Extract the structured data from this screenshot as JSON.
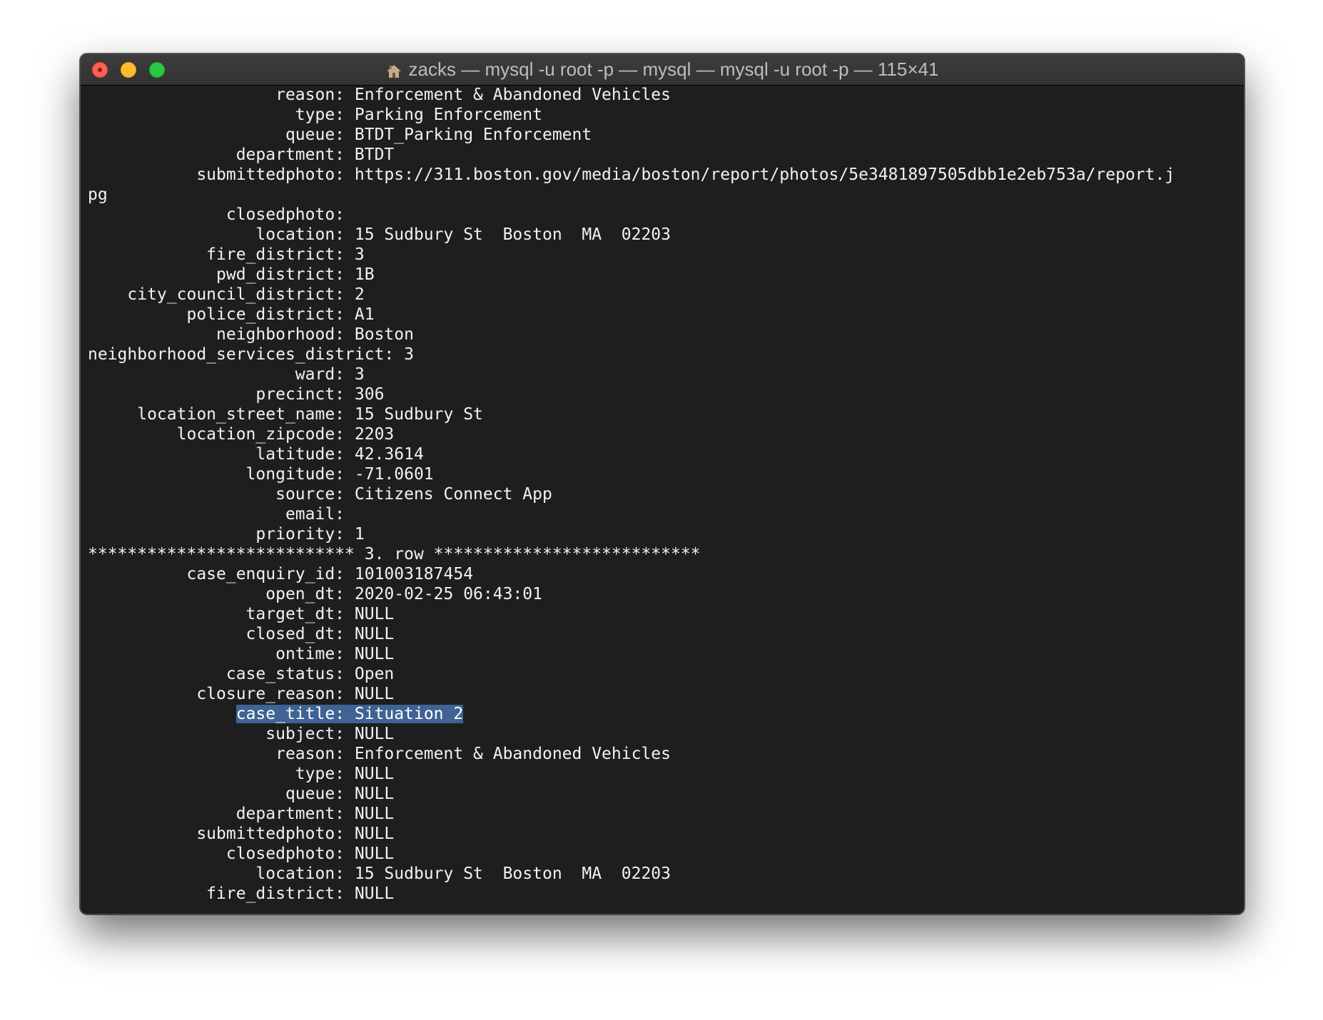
{
  "window": {
    "title": "zacks — mysql -u root -p — mysql — mysql -u root -p — 115×41",
    "title_icon": "house-icon"
  },
  "terminal": {
    "lines": [
      "                   reason: Enforcement & Abandoned Vehicles",
      "                     type: Parking Enforcement",
      "                    queue: BTDT_Parking Enforcement",
      "               department: BTDT",
      "           submittedphoto: https://311.boston.gov/media/boston/report/photos/5e3481897505dbb1e2eb753a/report.j",
      "pg",
      "              closedphoto: ",
      "                 location: 15 Sudbury St  Boston  MA  02203",
      "            fire_district: 3",
      "             pwd_district: 1B",
      "    city_council_district: 2",
      "          police_district: A1",
      "             neighborhood: Boston",
      "neighborhood_services_district: 3",
      "                     ward: 3",
      "                 precinct: 306",
      "     location_street_name: 15 Sudbury St",
      "         location_zipcode: 2203",
      "                 latitude: 42.3614",
      "                longitude: -71.0601",
      "                   source: Citizens Connect App",
      "                    email: ",
      "                 priority: 1",
      "*************************** 3. row ***************************",
      "          case_enquiry_id: 101003187454",
      "                  open_dt: 2020-02-25 06:43:01",
      "                target_dt: NULL",
      "                closed_dt: NULL",
      "                   ontime: NULL",
      "              case_status: Open",
      "           closure_reason: NULL",
      "               case_title: Situation 2",
      "                  subject: NULL",
      "                   reason: Enforcement & Abandoned Vehicles",
      "                     type: NULL",
      "                    queue: NULL",
      "               department: NULL",
      "           submittedphoto: NULL",
      "              closedphoto: NULL",
      "                 location: 15 Sudbury St  Boston  MA  02203",
      "            fire_district: NULL"
    ],
    "selection": {
      "line_index": 31,
      "prefix": "               ",
      "selected_text": "case_title: Situation 2"
    }
  },
  "colors": {
    "background": "#1e1e1e",
    "text": "#f2f2f2",
    "selection": "#3f6394"
  }
}
